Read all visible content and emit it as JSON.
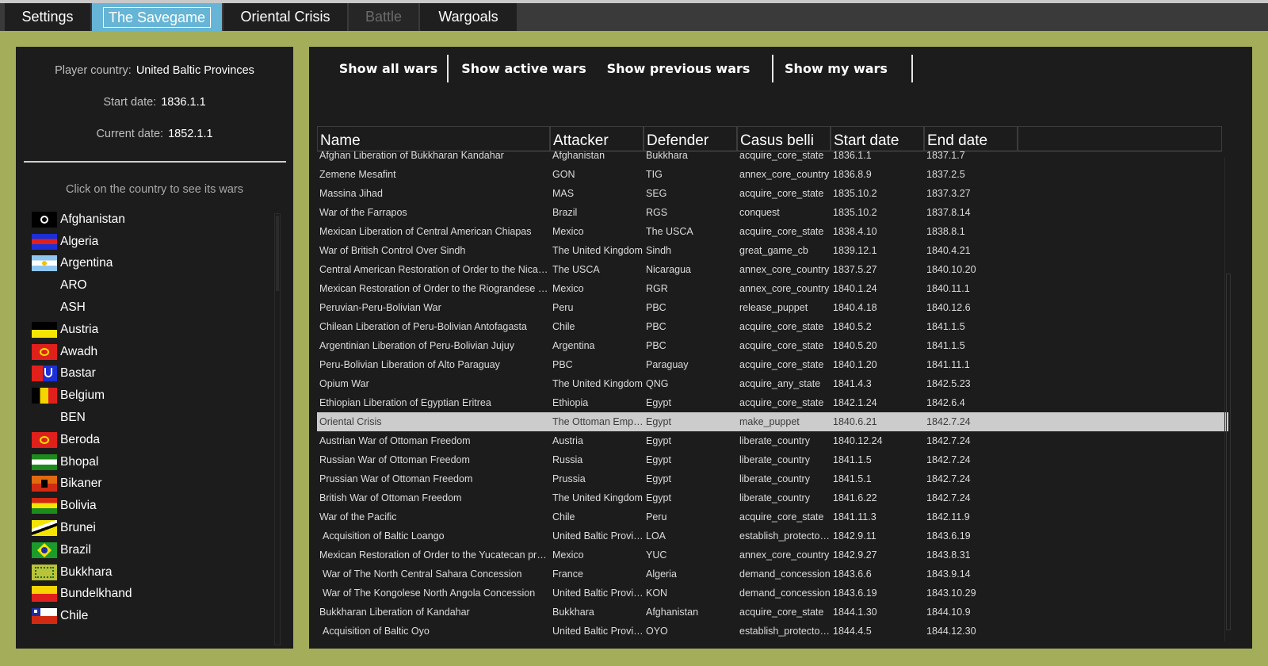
{
  "tabs": [
    {
      "label": "Settings",
      "state": "normal"
    },
    {
      "label": "The Savegame",
      "state": "active"
    },
    {
      "label": "Oriental Crisis",
      "state": "normal"
    },
    {
      "label": "Battle",
      "state": "disabled"
    },
    {
      "label": "Wargoals",
      "state": "normal"
    }
  ],
  "info": {
    "player_label": "Player country:",
    "player_value": "United Baltic Provinces",
    "start_label": "Start date:",
    "start_value": "1836.1.1",
    "current_label": "Current date:",
    "current_value": "1852.1.1",
    "hint": "Click on the country to see its wars"
  },
  "countries": [
    {
      "name": "Afghanistan",
      "flag": "afghanistan"
    },
    {
      "name": "Algeria",
      "flag": "algeria"
    },
    {
      "name": "Argentina",
      "flag": "argentina"
    },
    {
      "name": "ARO",
      "flag": "none"
    },
    {
      "name": "ASH",
      "flag": "none"
    },
    {
      "name": "Austria",
      "flag": "austria"
    },
    {
      "name": "Awadh",
      "flag": "awadh"
    },
    {
      "name": "Bastar",
      "flag": "bastar"
    },
    {
      "name": "Belgium",
      "flag": "belgium"
    },
    {
      "name": "BEN",
      "flag": "none"
    },
    {
      "name": "Beroda",
      "flag": "beroda"
    },
    {
      "name": "Bhopal",
      "flag": "bhopal"
    },
    {
      "name": "Bikaner",
      "flag": "bikaner"
    },
    {
      "name": "Bolivia",
      "flag": "bolivia"
    },
    {
      "name": "Brunei",
      "flag": "brunei"
    },
    {
      "name": "Brazil",
      "flag": "brazil"
    },
    {
      "name": "Bukkhara",
      "flag": "bukkhara"
    },
    {
      "name": "Bundelkhand",
      "flag": "bundelkhand"
    },
    {
      "name": "Chile",
      "flag": "chile"
    }
  ],
  "filters": {
    "all": "Show all wars",
    "active": "Show active wars",
    "previous": "Show previous wars",
    "mine": "Show my wars"
  },
  "columns": [
    "Name",
    "Attacker",
    "Defender",
    "Casus belli",
    "Start date",
    "End date"
  ],
  "wars": [
    [
      "Afghan Liberation of Bukkharan Kandahar",
      "Afghanistan",
      "Bukkhara",
      "acquire_core_state",
      "1836.1.1",
      "1837.1.7"
    ],
    [
      "Zemene Mesafint",
      "GON",
      "TIG",
      "annex_core_country",
      "1836.8.9",
      "1837.2.5"
    ],
    [
      "Massina Jihad",
      "MAS",
      "SEG",
      "acquire_core_state",
      "1835.10.2",
      "1837.3.27"
    ],
    [
      "War of the Farrapos",
      "Brazil",
      "RGS",
      "conquest",
      "1835.10.2",
      "1837.8.14"
    ],
    [
      "Mexican Liberation of Central American Chiapas",
      "Mexico",
      "The USCA",
      "acquire_core_state",
      "1838.4.10",
      "1838.8.1"
    ],
    [
      "War of British Control Over Sindh",
      "The United Kingdom",
      "Sindh",
      "great_game_cb",
      "1839.12.1",
      "1840.4.21"
    ],
    [
      "Central American Restoration of Order to the Nicaragua Republic",
      "The USCA",
      "Nicaragua",
      "annex_core_country",
      "1837.5.27",
      "1840.10.20"
    ],
    [
      "Mexican Restoration of Order to the Riograndese Republic",
      "Mexico",
      "RGR",
      "annex_core_country",
      "1840.1.24",
      "1840.11.1"
    ],
    [
      "Peruvian-Peru-Bolivian War",
      "Peru",
      "PBC",
      "release_puppet",
      "1840.4.18",
      "1840.12.6"
    ],
    [
      "Chilean Liberation of Peru-Bolivian Antofagasta",
      "Chile",
      "PBC",
      "acquire_core_state",
      "1840.5.2",
      "1841.1.5"
    ],
    [
      "Argentinian Liberation of Peru-Bolivian Jujuy",
      "Argentina",
      "PBC",
      "acquire_core_state",
      "1840.5.20",
      "1841.1.5"
    ],
    [
      "Peru-Bolivian Liberation of Alto Paraguay",
      "PBC",
      "Paraguay",
      "acquire_core_state",
      "1840.1.20",
      "1841.11.1"
    ],
    [
      "Opium War",
      "The United Kingdom",
      "QNG",
      "acquire_any_state",
      "1841.4.3",
      "1842.5.23"
    ],
    [
      "Ethiopian Liberation of Egyptian Eritrea",
      "Ethiopia",
      "Egypt",
      "acquire_core_state",
      "1842.1.24",
      "1842.6.4"
    ],
    [
      "Oriental Crisis",
      "The Ottoman Empire",
      "Egypt",
      "make_puppet",
      "1840.6.21",
      "1842.7.24"
    ],
    [
      "Austrian War of Ottoman Freedom",
      "Austria",
      "Egypt",
      "liberate_country",
      "1840.12.24",
      "1842.7.24"
    ],
    [
      "Russian War of Ottoman Freedom",
      "Russia",
      "Egypt",
      "liberate_country",
      "1841.1.5",
      "1842.7.24"
    ],
    [
      "Prussian War of Ottoman Freedom",
      "Prussia",
      "Egypt",
      "liberate_country",
      "1841.5.1",
      "1842.7.24"
    ],
    [
      "British War of Ottoman Freedom",
      "The United Kingdom",
      "Egypt",
      "liberate_country",
      "1841.6.22",
      "1842.7.24"
    ],
    [
      "War of the Pacific",
      "Chile",
      "Peru",
      "acquire_core_state",
      "1841.11.3",
      "1842.11.9"
    ],
    [
      " Acquisition of Baltic Loango",
      "United Baltic Provinces",
      "LOA",
      "establish_protectorate",
      "1842.9.11",
      "1843.6.19"
    ],
    [
      "Mexican Restoration of Order to the Yucatecan province",
      "Mexico",
      "YUC",
      "annex_core_country",
      "1842.9.27",
      "1843.8.31"
    ],
    [
      " War of The North Central Sahara Concession",
      "France",
      "Algeria",
      "demand_concession",
      "1843.6.6",
      "1843.9.14"
    ],
    [
      " War of The Kongolese North Angola Concession",
      "United Baltic Provinces",
      "KON",
      "demand_concession",
      "1843.6.19",
      "1843.10.29"
    ],
    [
      "Bukkharan Liberation of Kandahar",
      "Bukkhara",
      "Afghanistan",
      "acquire_core_state",
      "1844.1.30",
      "1844.10.9"
    ],
    [
      " Acquisition of Baltic Oyo",
      "United Baltic Provinces",
      "OYO",
      "establish_protectorate",
      "1844.4.5",
      "1844.12.30"
    ]
  ],
  "selected_war": "Oriental Crisis"
}
